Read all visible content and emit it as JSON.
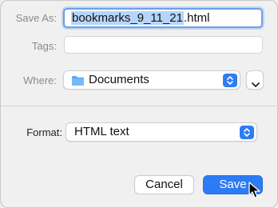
{
  "dialog": {
    "save_as_label": "Save As:",
    "filename_selected": "bookmarks_9_11_21",
    "filename_ext": ".html",
    "tags_label": "Tags:",
    "tags_value": "",
    "where_label": "Where:",
    "where_value": "Documents",
    "format_label": "Format:",
    "format_value": "HTML text",
    "cancel_label": "Cancel",
    "save_label": "Save"
  },
  "colors": {
    "accent": "#2c7cf6",
    "selection": "#b6d5fb",
    "folder": "#5aa9f0"
  },
  "icons": [
    "folder-icon",
    "updown-chevron-icon",
    "chevron-down-icon",
    "mouse-pointer-icon"
  ]
}
